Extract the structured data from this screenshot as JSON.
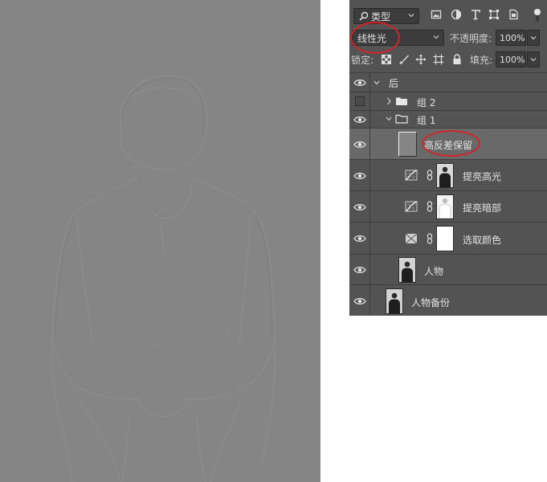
{
  "panel": {
    "filter": {
      "kind_label": "类型",
      "icons": [
        "image-filter-icon",
        "adjustment-filter-icon",
        "type-filter-icon",
        "shape-filter-icon",
        "smart-object-filter-icon"
      ]
    },
    "blend_mode": "线性光",
    "opacity_label": "不透明度:",
    "opacity_value": "100%",
    "lock_label": "锁定:",
    "fill_label": "填充:",
    "fill_value": "100%"
  },
  "layers": [
    {
      "name": "后",
      "type": "group",
      "visible": true,
      "expanded": true
    },
    {
      "name": "组 2",
      "type": "group",
      "visible": false,
      "expanded": false
    },
    {
      "name": "组 1",
      "type": "group",
      "visible": true,
      "expanded": true
    },
    {
      "name": "高反差保留",
      "type": "pixel",
      "visible": true,
      "selected": true
    },
    {
      "name": "提亮高光",
      "type": "curves",
      "visible": true
    },
    {
      "name": "提亮暗部",
      "type": "curves",
      "visible": true
    },
    {
      "name": "选取颜色",
      "type": "selective-color",
      "visible": true
    },
    {
      "name": "人物",
      "type": "pixel",
      "visible": true
    },
    {
      "name": "人物备份",
      "type": "pixel",
      "visible": true
    }
  ],
  "colors": {
    "panel_bg": "#535353",
    "canvas_gray": "#858585",
    "annotation_red": "#d1252a"
  }
}
